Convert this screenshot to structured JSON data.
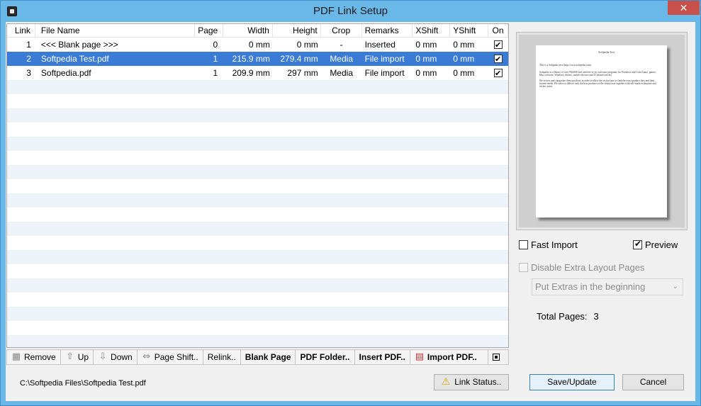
{
  "window": {
    "title": "PDF Link Setup",
    "close": "✕"
  },
  "table": {
    "headers": {
      "link": "Link",
      "file": "File Name",
      "page": "Page",
      "width": "Width",
      "height": "Height",
      "crop": "Crop",
      "remarks": "Remarks",
      "xshift": "XShift",
      "yshift": "YShift",
      "on": "On"
    },
    "rows": [
      {
        "link": "1",
        "file": "<<< Blank page >>>",
        "page": "0",
        "width": "0 mm",
        "height": "0 mm",
        "crop": "-",
        "remarks": "Inserted",
        "xshift": "0 mm",
        "yshift": "0 mm",
        "on": true,
        "selected": false
      },
      {
        "link": "2",
        "file": "Softpedia Test.pdf",
        "page": "1",
        "width": "215.9 mm",
        "height": "279.4 mm",
        "crop": "Media",
        "remarks": "File import",
        "xshift": "0 mm",
        "yshift": "0 mm",
        "on": true,
        "selected": true
      },
      {
        "link": "3",
        "file": "Softpedia.pdf",
        "page": "1",
        "width": "209.9 mm",
        "height": "297 mm",
        "crop": "Media",
        "remarks": "File import",
        "xshift": "0 mm",
        "yshift": "0 mm",
        "on": true,
        "selected": false
      }
    ]
  },
  "toolbar": {
    "remove": "Remove",
    "up": "Up",
    "down": "Down",
    "page_shift": "Page Shift..",
    "relink": "Relink..",
    "blank_page": "Blank Page",
    "pdf_folder": "PDF Folder..",
    "insert_pdf": "Insert PDF..",
    "import_pdf": "Import PDF.."
  },
  "status": {
    "path": "C:\\Softpedia Files\\Softpedia Test.pdf"
  },
  "buttons": {
    "link_status": "Link Status..",
    "save": "Save/Update",
    "cancel": "Cancel"
  },
  "preview": {
    "doc_title": "Softpedia Test",
    "lines": [
      "This is a Softpedia test (http://www.softpedia.com)",
      "Softpedia is a library of over 900,000 free and free-to-try software programs for Windows and Unix/Linux, games,",
      "Mac software, Windows drivers, mobile devices and IT-related articles.",
      "We review and categorize these products in order to allow the visitor/user to find the exact product they and their",
      "system needs. We strive to deliver only the best products to the visitor/user together with self-made evaluation and",
      "review notes."
    ]
  },
  "options": {
    "fast_import": {
      "label": "Fast Import",
      "checked": false
    },
    "preview": {
      "label": "Preview",
      "checked": true
    },
    "disable_extra": {
      "label": "Disable Extra Layout Pages",
      "checked": false
    },
    "extras_select": "Put Extras in the beginning",
    "total_label": "Total Pages:",
    "total_value": "3"
  }
}
